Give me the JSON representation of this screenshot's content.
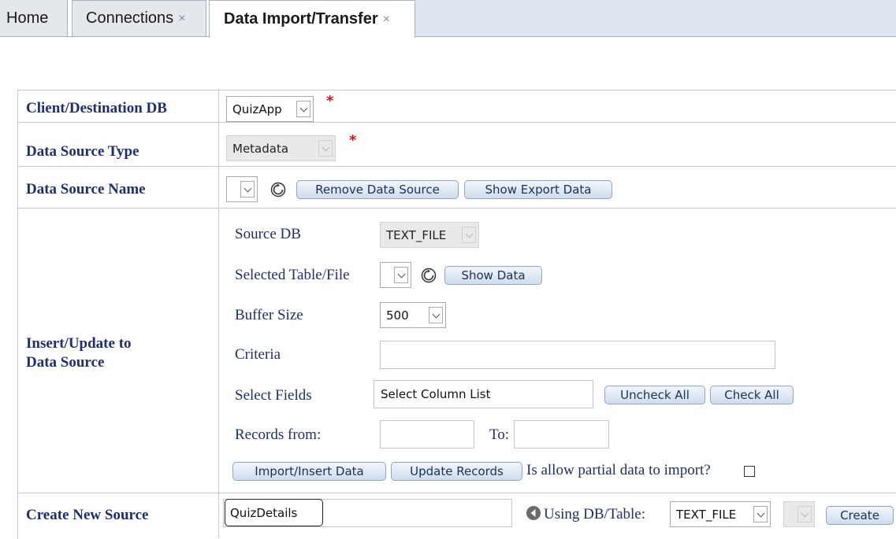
{
  "tabs": [
    {
      "label": "Home",
      "closable": false
    },
    {
      "label": "Connections",
      "closable": true
    },
    {
      "label": "Data Import/Transfer",
      "closable": true,
      "active": true
    }
  ],
  "close_glyph": "×",
  "form": {
    "client_destination_db": {
      "label": "Client/Destination DB",
      "value": "QuizApp",
      "required_mark": "*"
    },
    "data_source_type": {
      "label": "Data Source Type",
      "value": "Metadata",
      "required_mark": "*"
    },
    "data_source_name": {
      "label": "Data Source Name",
      "value": "",
      "remove_button": "Remove Data Source",
      "export_button": "Show Export Data"
    },
    "insert_update": {
      "label_line1": "Insert/Update to",
      "label_line2": "Data Source",
      "source_db": {
        "label": "Source DB",
        "value": "TEXT_FILE"
      },
      "selected_table": {
        "label": "Selected Table/File",
        "value": "",
        "show_button": "Show Data"
      },
      "buffer_size": {
        "label": "Buffer Size",
        "value": "500"
      },
      "criteria": {
        "label": "Criteria",
        "value": ""
      },
      "select_fields": {
        "label": "Select Fields",
        "value": "Select Column List",
        "uncheck_button": "Uncheck All",
        "check_button": "Check All"
      },
      "records_from": {
        "label": "Records from:",
        "from_value": "",
        "to_label": "To:",
        "to_value": ""
      },
      "import_button": "Import/Insert Data",
      "update_button": "Update Records",
      "partial_label": "Is allow partial data to import?",
      "partial_checked": false
    },
    "create_new_source": {
      "label": "Create New Source",
      "value": "QuizDetails",
      "using_label": "Using DB/Table:",
      "db_value": "TEXT_FILE",
      "table_value": "",
      "create_button": "Create"
    }
  },
  "icons": {
    "refresh": "refresh-icon",
    "back": "back-arrow-icon",
    "dropdown": "chevron-down-icon"
  },
  "colors": {
    "label": "#1f2f6e",
    "required": "#d01818",
    "button_border": "#8fa6c6",
    "tab_active_bg": "#ffffff",
    "tab_inactive_bg": "#e4e7ec"
  }
}
